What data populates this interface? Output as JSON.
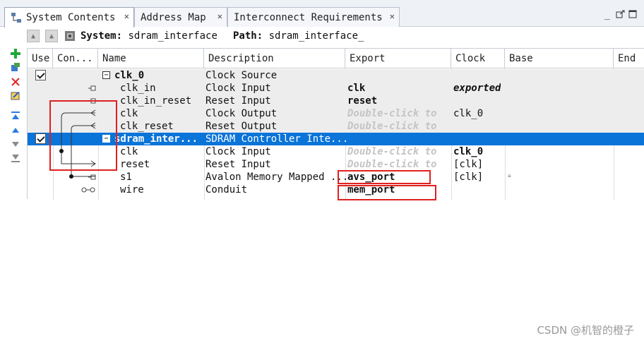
{
  "tabs": [
    {
      "label": "System Contents",
      "active": true
    },
    {
      "label": "Address Map",
      "active": false
    },
    {
      "label": "Interconnect Requirements",
      "active": false
    }
  ],
  "toolbar": {
    "system_label": "System:",
    "system_value": "sdram_interface",
    "path_label": "Path:",
    "path_value": "sdram_interface_"
  },
  "columns": [
    "Use",
    "Con...",
    "Name",
    "Description",
    "Export",
    "Clock",
    "Base",
    "End"
  ],
  "rows": [
    {
      "use": true,
      "expander": "⊟",
      "name": "clk_0",
      "name_bold": true,
      "description": "Clock Source",
      "export": "",
      "export_style": "",
      "clock": "",
      "clock_style": "",
      "style": "gray"
    },
    {
      "use": false,
      "expander": "",
      "name": "clk_in",
      "description": "Clock Input",
      "export": "clk",
      "export_style": "bold",
      "clock": "exported",
      "clock_style": "italic-bold",
      "style": "gray"
    },
    {
      "use": false,
      "expander": "",
      "name": "clk_in_reset",
      "description": "Reset Input",
      "export": "reset",
      "export_style": "bold",
      "clock": "",
      "clock_style": "",
      "style": "gray"
    },
    {
      "use": false,
      "expander": "",
      "name": "clk",
      "description": "Clock Output",
      "export": "Double-click to",
      "export_style": "hint",
      "clock": "clk_0",
      "clock_style": "",
      "style": "gray"
    },
    {
      "use": false,
      "expander": "",
      "name": "clk_reset",
      "description": "Reset Output",
      "export": "Double-click to",
      "export_style": "hint",
      "clock": "",
      "clock_style": "",
      "style": "gray"
    },
    {
      "use": true,
      "expander": "⊟",
      "name": "sdram_inter...",
      "name_bold": true,
      "description": "SDRAM Controller Inte...",
      "export": "",
      "export_style": "",
      "clock": "",
      "clock_style": "",
      "style": "sel"
    },
    {
      "use": false,
      "expander": "",
      "name": "clk",
      "description": "Clock Input",
      "export": "Double-click to",
      "export_style": "hint",
      "clock": "clk_0",
      "clock_style": "bold",
      "style": ""
    },
    {
      "use": false,
      "expander": "",
      "name": "reset",
      "description": "Reset Input",
      "export": "Double-click to",
      "export_style": "hint",
      "clock": "[clk]",
      "clock_style": "",
      "style": ""
    },
    {
      "use": false,
      "expander": "",
      "name": "s1",
      "description": "Avalon Memory Mapped ...",
      "export": "avs_port",
      "export_style": "bold",
      "clock": "[clk]",
      "clock_style": "",
      "style": ""
    },
    {
      "use": false,
      "expander": "",
      "name": "wire",
      "description": "Conduit",
      "export": "mem_port",
      "export_style": "bold",
      "clock": "",
      "clock_style": "",
      "style": ""
    }
  ],
  "watermark": "CSDN @机智的橙子",
  "colors": {
    "selection": "#0a74d9",
    "highlight_box": "#e02020",
    "hint_text": "#c4c4c4"
  }
}
